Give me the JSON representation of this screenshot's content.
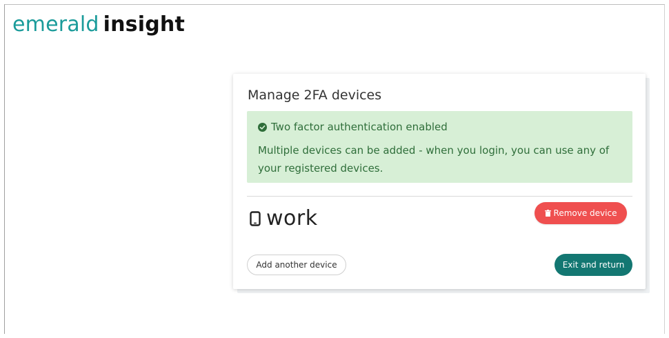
{
  "header": {
    "logo_part1": "emerald",
    "logo_part2": "insight"
  },
  "card": {
    "title": "Manage 2FA devices",
    "alert": {
      "heading": "Two factor authentication enabled",
      "body": "Multiple devices can be added - when you login, you can use any of your registered devices.",
      "icon": "check-circle-icon"
    },
    "device": {
      "icon": "mobile-phone-icon",
      "name": "work"
    },
    "remove_label": "Remove device",
    "add_label": "Add another device",
    "exit_label": "Exit and return"
  },
  "colors": {
    "brand_teal": "#1a9b9a",
    "alert_bg": "#d7efd6",
    "alert_text": "#2f6e3a",
    "danger": "#ef4f4f",
    "primary": "#137772"
  }
}
